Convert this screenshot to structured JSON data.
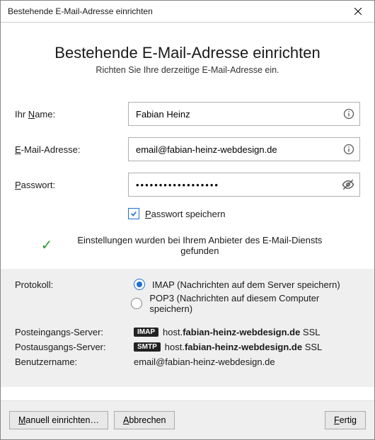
{
  "window": {
    "title": "Bestehende E-Mail-Adresse einrichten"
  },
  "header": {
    "title": "Bestehende E-Mail-Adresse einrichten",
    "subtitle": "Richten Sie Ihre derzeitige E-Mail-Adresse ein."
  },
  "fields": {
    "name": {
      "label_pre": "Ihr ",
      "label_ul": "N",
      "label_post": "ame:",
      "value": "Fabian Heinz"
    },
    "email": {
      "label_ul": "E",
      "label_post": "-Mail-Adresse:",
      "value": "email@fabian-heinz-webdesign.de"
    },
    "password": {
      "label_ul": "P",
      "label_post": "asswort:",
      "value": "••••••••••••••••••"
    },
    "remember": {
      "checked": true,
      "label_ul": "P",
      "label_post": "asswort speichern"
    }
  },
  "status": {
    "message": "Einstellungen wurden bei Ihrem Anbieter des E-Mail-Diensts gefunden"
  },
  "protocol": {
    "label": "Protokoll:",
    "options": {
      "imap": {
        "label": "IMAP (Nachrichten auf dem Server speichern)",
        "selected": true
      },
      "pop3": {
        "label": "POP3 (Nachrichten auf diesem Computer speichern)",
        "selected": false
      }
    }
  },
  "servers": {
    "incoming": {
      "label": "Posteingangs-Server:",
      "badge": "IMAP",
      "host_pre": "host.",
      "host_bold": "fabian-heinz-webdesign.de",
      "ssl": " SSL"
    },
    "outgoing": {
      "label": "Postausgangs-Server:",
      "badge": "SMTP",
      "host_pre": "host.",
      "host_bold": "fabian-heinz-webdesign.de",
      "ssl": " SSL"
    },
    "username": {
      "label": "Benutzername:",
      "value": "email@fabian-heinz-webdesign.de"
    }
  },
  "buttons": {
    "manual_ul": "M",
    "manual_post": "anuell einrichten…",
    "cancel_ul": "A",
    "cancel_post": "bbrechen",
    "done_ul": "F",
    "done_post": "ertig"
  }
}
